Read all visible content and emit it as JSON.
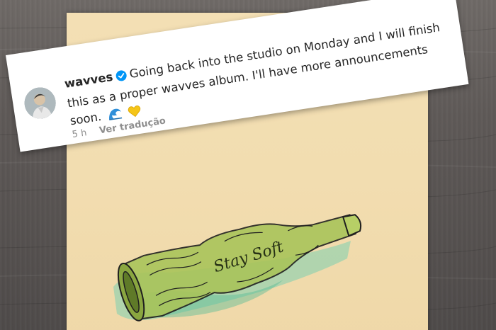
{
  "comment": {
    "username": "wavves",
    "body_line_1": "Going back into the studio on Monday and I will finish",
    "body_line_2": "this as a proper wavves album. I'll have more announcements",
    "body_line_3": "soon.",
    "time": "5 h",
    "translate_label": "Ver tradução",
    "verified_icon": "verified-badge-icon",
    "emojis": [
      "wave-emoji",
      "yellow-heart-emoji"
    ]
  },
  "artwork": {
    "bottle_script_text": "Stay Soft"
  },
  "colors": {
    "verified_blue": "#0095f6",
    "text_primary": "#262626",
    "text_secondary": "#8e8e8e",
    "paper": "#f2ddb0",
    "bottle_green": "#9fbf4a",
    "watercolor_teal": "#6fcaa8"
  }
}
